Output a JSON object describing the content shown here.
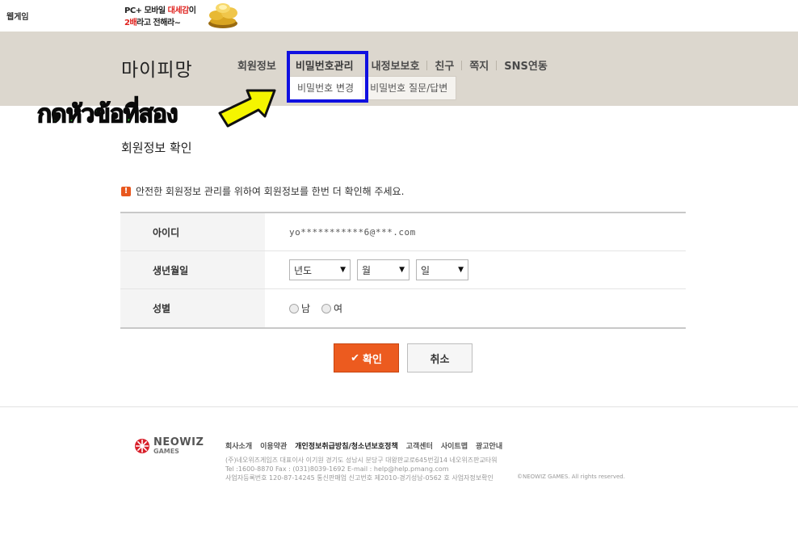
{
  "topbar": {
    "webgame_label": "웹게임",
    "banner": {
      "line1_prefix": "PC+ 모바일 ",
      "line1_highlight": "대세감",
      "line1_suffix": "이",
      "line2_highlight": "2배",
      "line2_suffix": "라고 전해라~"
    }
  },
  "header": {
    "title": "마이피망",
    "menu": [
      {
        "label": "회원정보"
      },
      {
        "label": "비밀번호관리"
      },
      {
        "label": "내정보보호"
      },
      {
        "label": "친구"
      },
      {
        "label": "쪽지"
      },
      {
        "label": "SNS연동"
      }
    ],
    "submenu": [
      {
        "label": "비밀번호 변경"
      },
      {
        "label": "비밀번호 질문/답변"
      }
    ]
  },
  "annotation": {
    "text": "กดหัวข้อที่สอง",
    "text_color": "#3bd43b",
    "arrow_color": "#f5f500",
    "box_color": "#1010e0"
  },
  "content": {
    "section_title": "회원정보 확인",
    "notice": "안전한 회원정보 관리를 위하여 회원정보를 한번 더 확인해 주세요.",
    "form": {
      "id_label": "아이디",
      "id_value": "yo***********6@***.com",
      "birth_label": "생년월일",
      "year_value": "년도",
      "month_value": "월",
      "day_value": "일",
      "gender_label": "성별",
      "male_label": "남",
      "female_label": "여"
    },
    "confirm_label": "확인",
    "cancel_label": "취소"
  },
  "footer": {
    "logo_name": "NEOWIZ",
    "logo_sub": "GAMES",
    "links": [
      {
        "label": "회사소개"
      },
      {
        "label": "이용약관"
      },
      {
        "label": "개인정보취급방침/청소년보호정책"
      },
      {
        "label": "고객센터"
      },
      {
        "label": "사이트맵"
      },
      {
        "label": "광고안내"
      }
    ],
    "info_line1": "(주)네오위즈게임즈    대표이사 이기원    경기도 성남시 분당구 대왕판교로645번길14 네오위즈판교타워",
    "info_line2": "Tel :1600-8870 Fax : (031)8039-1692  E-mail : help@help.pmang.com",
    "info_line3": "사업자등록번호 120-87-14245 통신판매업 신고번호 제2010-경기성남-0562 호  사업자정보확인",
    "copyright": "©NEOWIZ GAMES. All rights reserved.",
    "accent_color": "#e8571e"
  }
}
